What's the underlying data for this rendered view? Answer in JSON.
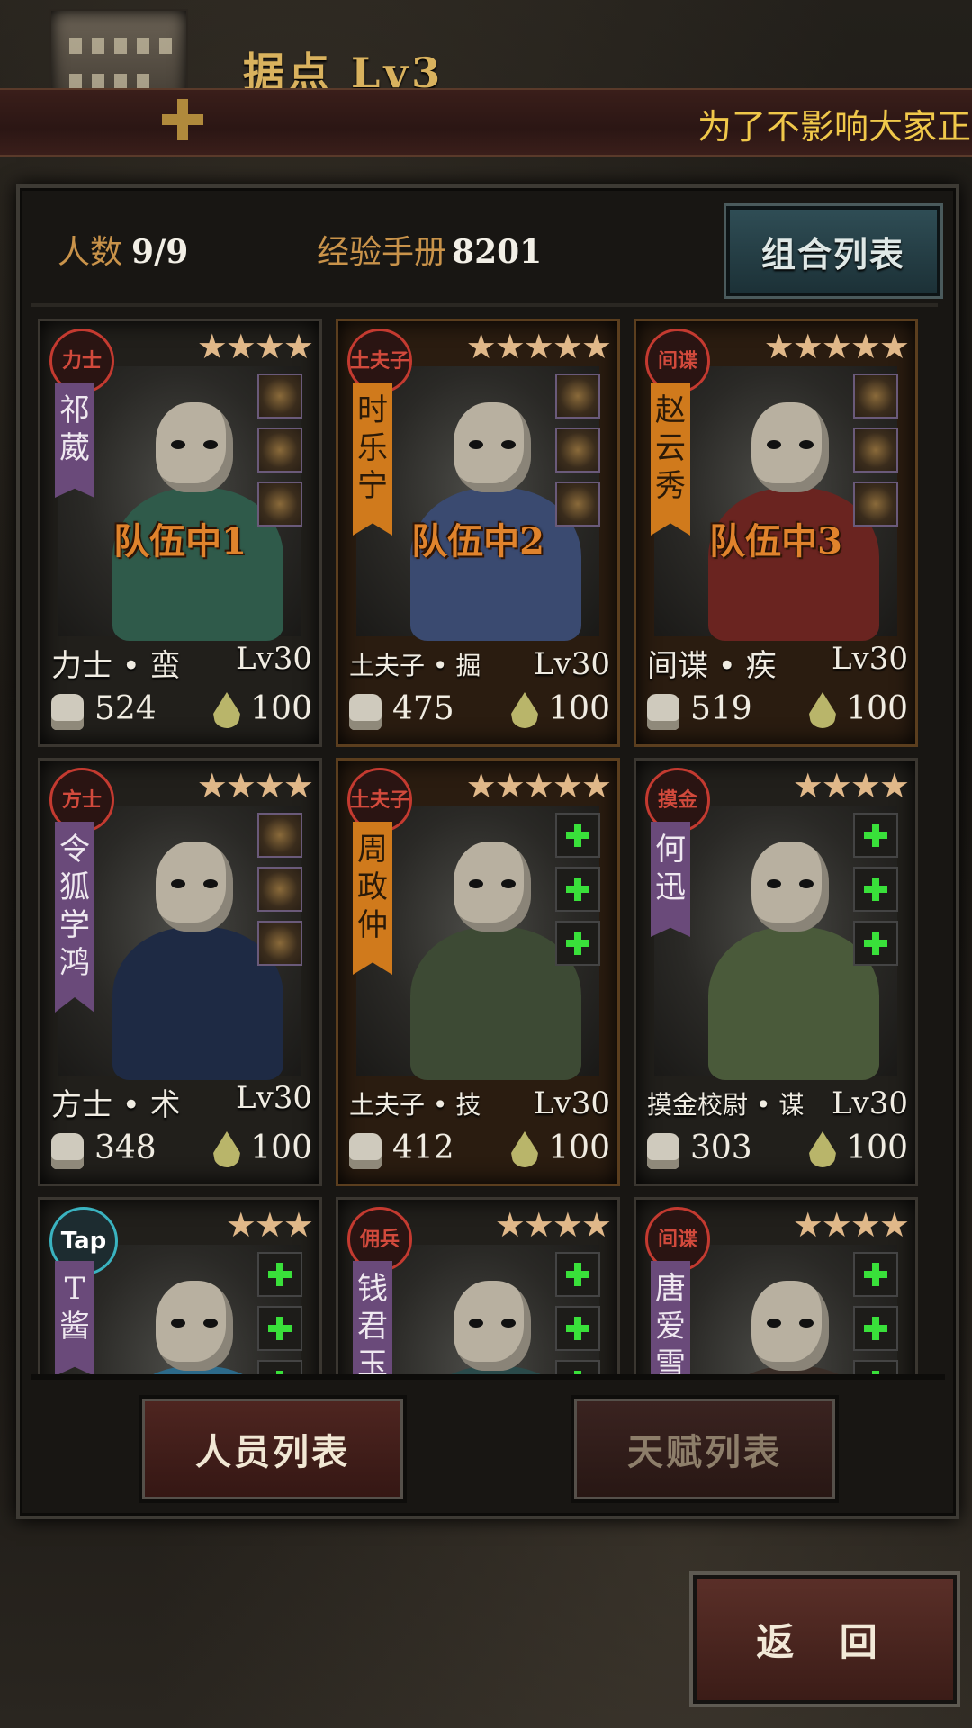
{
  "header": {
    "title": "据点  Lv3",
    "marquee": "为了不影响大家正"
  },
  "stats": {
    "count_label": "人数",
    "count_value": "9/9",
    "exp_label": "经验手册",
    "exp_value": "8201"
  },
  "combo_button": "组合列表",
  "cards": [
    {
      "badge": "力士",
      "stars": "★★★★",
      "name": [
        "祁",
        "葳"
      ],
      "banner": "purple",
      "team": "队伍中1",
      "slots": [
        "item",
        "item",
        "item"
      ],
      "title": "力士 • 蛮",
      "level": "Lv30",
      "power": "524",
      "stamina": "100",
      "gold": false,
      "shirt": "#2f5a4a"
    },
    {
      "badge": "土夫子",
      "stars": "★★★★★",
      "name": [
        "时",
        "乐",
        "宁"
      ],
      "banner": "orange",
      "team": "队伍中2",
      "slots": [
        "item",
        "item",
        "item"
      ],
      "title": "土夫子 • 掘",
      "level": "Lv30",
      "power": "475",
      "stamina": "100",
      "gold": true,
      "shirt": "#3a4a70"
    },
    {
      "badge": "间谍",
      "stars": "★★★★★",
      "name": [
        "赵",
        "云",
        "秀"
      ],
      "banner": "orange",
      "team": "队伍中3",
      "slots": [
        "item",
        "item",
        "item"
      ],
      "title": "间谍 • 疾",
      "level": "Lv30",
      "power": "519",
      "stamina": "100",
      "gold": true,
      "shirt": "#6a2420"
    },
    {
      "badge": "方士",
      "stars": "★★★★",
      "name": [
        "令",
        "狐",
        "学",
        "鸿"
      ],
      "banner": "purple",
      "team": "",
      "slots": [
        "item",
        "item",
        "item"
      ],
      "title": "方士 • 术",
      "level": "Lv30",
      "power": "348",
      "stamina": "100",
      "gold": false,
      "shirt": "#1e2a44"
    },
    {
      "badge": "土夫子",
      "stars": "★★★★★",
      "name": [
        "周",
        "政",
        "仲"
      ],
      "banner": "orange",
      "team": "",
      "slots": [
        "plus",
        "plus",
        "plus"
      ],
      "title": "土夫子 • 技",
      "level": "Lv30",
      "power": "412",
      "stamina": "100",
      "gold": true,
      "shirt": "#3d4a34"
    },
    {
      "badge": "摸金",
      "stars": "★★★★",
      "name": [
        "何",
        "迅"
      ],
      "banner": "purple",
      "team": "",
      "slots": [
        "plus",
        "plus",
        "plus"
      ],
      "title": "摸金校尉 • 谋",
      "level": "Lv30",
      "power": "303",
      "stamina": "100",
      "gold": false,
      "shirt": "#4a5a3a"
    },
    {
      "badge": "Tap",
      "stars": "★★★",
      "name": [
        "T",
        "酱"
      ],
      "banner": "purple",
      "team": "",
      "slots": [
        "plus",
        "plus",
        "plus"
      ],
      "title": "",
      "level": "",
      "power": "",
      "stamina": "",
      "gold": false,
      "shirt": "#2c6a8a"
    },
    {
      "badge": "佣兵",
      "stars": "★★★★",
      "name": [
        "钱",
        "君",
        "玉"
      ],
      "banner": "purple",
      "team": "",
      "slots": [
        "plus",
        "plus",
        "plus"
      ],
      "title": "",
      "level": "",
      "power": "",
      "stamina": "",
      "gold": false,
      "shirt": "#2a4a4a"
    },
    {
      "badge": "间谍",
      "stars": "★★★★",
      "name": [
        "唐",
        "爱",
        "雪"
      ],
      "banner": "purple",
      "team": "",
      "slots": [
        "plus",
        "plus",
        "plus"
      ],
      "title": "",
      "level": "",
      "power": "",
      "stamina": "",
      "gold": false,
      "shirt": "#3a2e28"
    }
  ],
  "tabs": {
    "personnel": "人员列表",
    "talents": "天赋列表"
  },
  "back_button": "返 回",
  "colors": {
    "accent_gold": "#d9b25e",
    "label_orange": "#c9934a",
    "team_orange": "#e0832c",
    "plus_green": "#39e03a"
  }
}
